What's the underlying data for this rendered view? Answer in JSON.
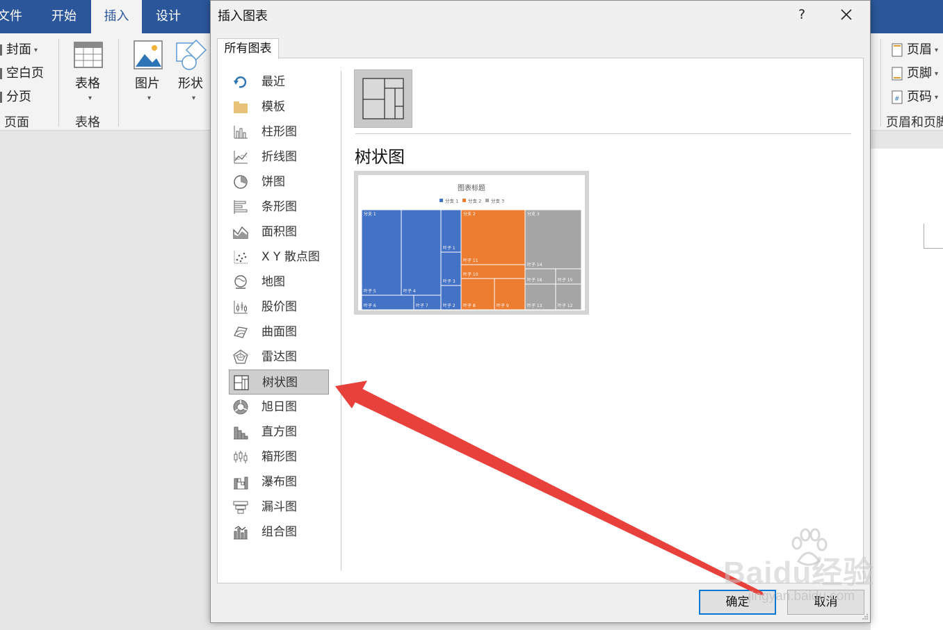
{
  "ribbon": {
    "tabs": [
      {
        "label": "文件",
        "active": false
      },
      {
        "label": "开始",
        "active": false
      },
      {
        "label": "插入",
        "active": true
      },
      {
        "label": "设计",
        "active": false
      }
    ],
    "pages_group": {
      "items": [
        "封面",
        "空白页",
        "分页"
      ],
      "label": "页面"
    },
    "table_group": {
      "button_label": "表格",
      "label": "表格"
    },
    "illustrations": {
      "picture_label": "图片",
      "shape_label": "形状"
    },
    "header_footer_group": {
      "items": [
        "页眉",
        "页脚",
        "页码"
      ],
      "label": "页眉和页脚"
    }
  },
  "dialog": {
    "title": "插入图表",
    "help": "?",
    "tab_label": "所有图表",
    "categories": [
      {
        "label": "最近",
        "icon": "recent-icon"
      },
      {
        "label": "模板",
        "icon": "folder-icon"
      },
      {
        "label": "柱形图",
        "icon": "column-chart-icon"
      },
      {
        "label": "折线图",
        "icon": "line-chart-icon"
      },
      {
        "label": "饼图",
        "icon": "pie-chart-icon"
      },
      {
        "label": "条形图",
        "icon": "bar-chart-icon"
      },
      {
        "label": "面积图",
        "icon": "area-chart-icon"
      },
      {
        "label": "X Y 散点图",
        "icon": "scatter-chart-icon"
      },
      {
        "label": "地图",
        "icon": "map-chart-icon"
      },
      {
        "label": "股价图",
        "icon": "stock-chart-icon"
      },
      {
        "label": "曲面图",
        "icon": "surface-chart-icon"
      },
      {
        "label": "雷达图",
        "icon": "radar-chart-icon"
      },
      {
        "label": "树状图",
        "icon": "treemap-chart-icon",
        "selected": true
      },
      {
        "label": "旭日图",
        "icon": "sunburst-chart-icon"
      },
      {
        "label": "直方图",
        "icon": "histogram-chart-icon"
      },
      {
        "label": "箱形图",
        "icon": "box-whisker-chart-icon"
      },
      {
        "label": "瀑布图",
        "icon": "waterfall-chart-icon"
      },
      {
        "label": "漏斗图",
        "icon": "funnel-chart-icon"
      },
      {
        "label": "组合图",
        "icon": "combo-chart-icon"
      }
    ],
    "selected_chart_name": "树状图",
    "preview": {
      "title": "图表标题",
      "legend": [
        "分支 1",
        "分支 2",
        "分支 3"
      ],
      "colors": {
        "branch1": "#4472c4",
        "branch2": "#ed7d31",
        "branch3": "#a5a5a5"
      },
      "tiles": [
        "分支 1",
        "分支 2",
        "分支 3",
        "叶子 1",
        "叶子 2",
        "叶子 3",
        "叶子 4",
        "叶子 5",
        "叶子 6",
        "叶子 7",
        "叶子 8",
        "叶子 9",
        "叶子 10",
        "叶子 11",
        "叶子 12",
        "叶子 13",
        "叶子 14",
        "叶子 15",
        "叶子 16"
      ]
    },
    "ok_label": "确定",
    "cancel_label": "取消"
  },
  "watermark": {
    "brand": "Baidu经验",
    "url": "jingyan.baidu.com"
  }
}
